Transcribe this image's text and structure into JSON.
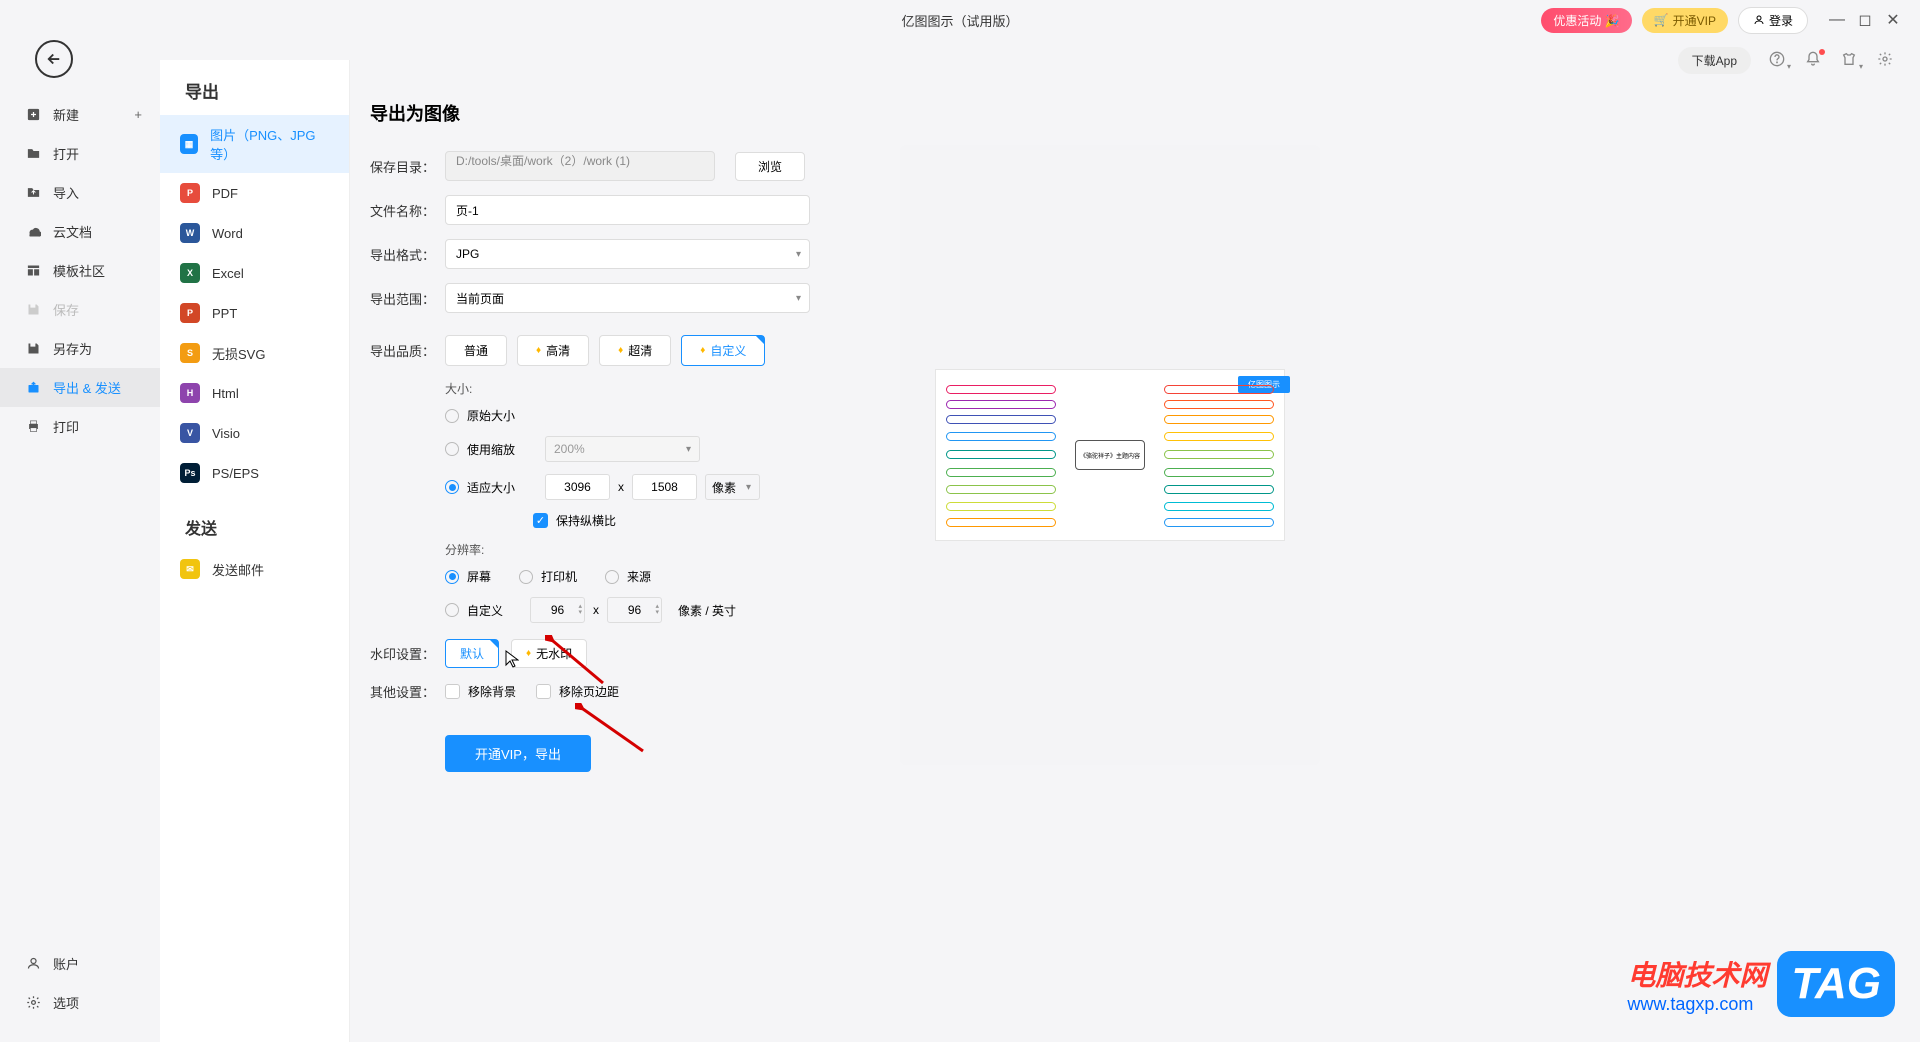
{
  "titlebar": {
    "app_title": "亿图图示（试用版）",
    "promo": "优惠活动",
    "vip": "开通VIP",
    "login": "登录"
  },
  "toolbar2": {
    "download_app": "下载App"
  },
  "sidebar": {
    "items": [
      {
        "icon": "plus-square",
        "label": "新建",
        "has_plus": true
      },
      {
        "icon": "folder",
        "label": "打开"
      },
      {
        "icon": "import",
        "label": "导入"
      },
      {
        "icon": "cloud",
        "label": "云文档"
      },
      {
        "icon": "template",
        "label": "模板社区"
      },
      {
        "icon": "save",
        "label": "保存",
        "disabled": true
      },
      {
        "icon": "save-as",
        "label": "另存为"
      },
      {
        "icon": "export",
        "label": "导出 & 发送",
        "active": true
      },
      {
        "icon": "print",
        "label": "打印"
      }
    ],
    "bottom": [
      {
        "icon": "user",
        "label": "账户"
      },
      {
        "icon": "gear",
        "label": "选项"
      }
    ]
  },
  "export_col": {
    "header": "导出",
    "formats": [
      {
        "label": "图片（PNG、JPG等）",
        "color": "#1890ff",
        "active": true
      },
      {
        "label": "PDF",
        "color": "#e74c3c"
      },
      {
        "label": "Word",
        "color": "#2b579a"
      },
      {
        "label": "Excel",
        "color": "#217346"
      },
      {
        "label": "PPT",
        "color": "#d24726"
      },
      {
        "label": "无损SVG",
        "color": "#f39c12"
      },
      {
        "label": "Html",
        "color": "#8e44ad"
      },
      {
        "label": "Visio",
        "color": "#2b579a"
      },
      {
        "label": "PS/EPS",
        "color": "#001e36"
      }
    ],
    "send_header": "发送",
    "send_items": [
      {
        "label": "发送邮件",
        "color": "#f1c40f"
      }
    ]
  },
  "form": {
    "title": "导出为图像",
    "save_dir_label": "保存目录：",
    "save_dir_value": "D:/tools/桌面/work（2）/work (1)",
    "browse": "浏览",
    "filename_label": "文件名称：",
    "filename_value": "页-1",
    "format_label": "导出格式：",
    "format_value": "JPG",
    "range_label": "导出范围：",
    "range_value": "当前页面",
    "quality_label": "导出品质：",
    "quality_options": [
      "普通",
      "高清",
      "超清",
      "自定义"
    ],
    "size_label": "大小:",
    "size_original": "原始大小",
    "size_scale": "使用缩放",
    "scale_value": "200%",
    "size_fit": "适应大小",
    "width": "3096",
    "height": "1508",
    "unit": "像素",
    "keep_ratio": "保持纵横比",
    "resolution_label": "分辨率:",
    "res_screen": "屏幕",
    "res_printer": "打印机",
    "res_source": "来源",
    "res_custom": "自定义",
    "res_x": "96",
    "res_y": "96",
    "res_unit": "像素 / 英寸",
    "watermark_label": "水印设置：",
    "wm_default": "默认",
    "wm_none": "无水印",
    "other_label": "其他设置：",
    "remove_bg": "移除背景",
    "remove_margin": "移除页边距",
    "export_btn": "开通VIP，导出"
  },
  "preview": {
    "badge": "亿图图示",
    "center": "《骆驼祥子》主题内容"
  },
  "watermark": {
    "line1": "电脑技术网",
    "line2": "www.tagxp.com",
    "tag": "TAG"
  },
  "multiply": "x"
}
